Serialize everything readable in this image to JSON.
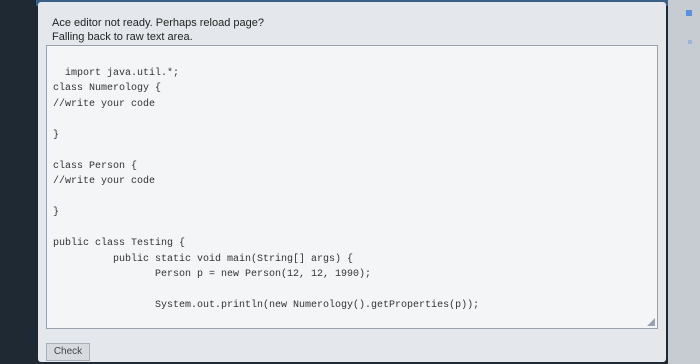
{
  "message": {
    "line1": "Ace editor not ready. Perhaps reload page?",
    "line2": "Falling back to raw text area."
  },
  "editor": {
    "code": "import java.util.*;\nclass Numerology {\n//write your code\n\n}\n\nclass Person {\n//write your code\n\n}\n\npublic class Testing {\n          public static void main(String[] args) {\n                 Person p = new Person(12, 12, 1990);\n\n                 System.out.println(new Numerology().getProperties(p));\n\n          }\n}"
  },
  "buttons": {
    "check_label": "Check"
  }
}
